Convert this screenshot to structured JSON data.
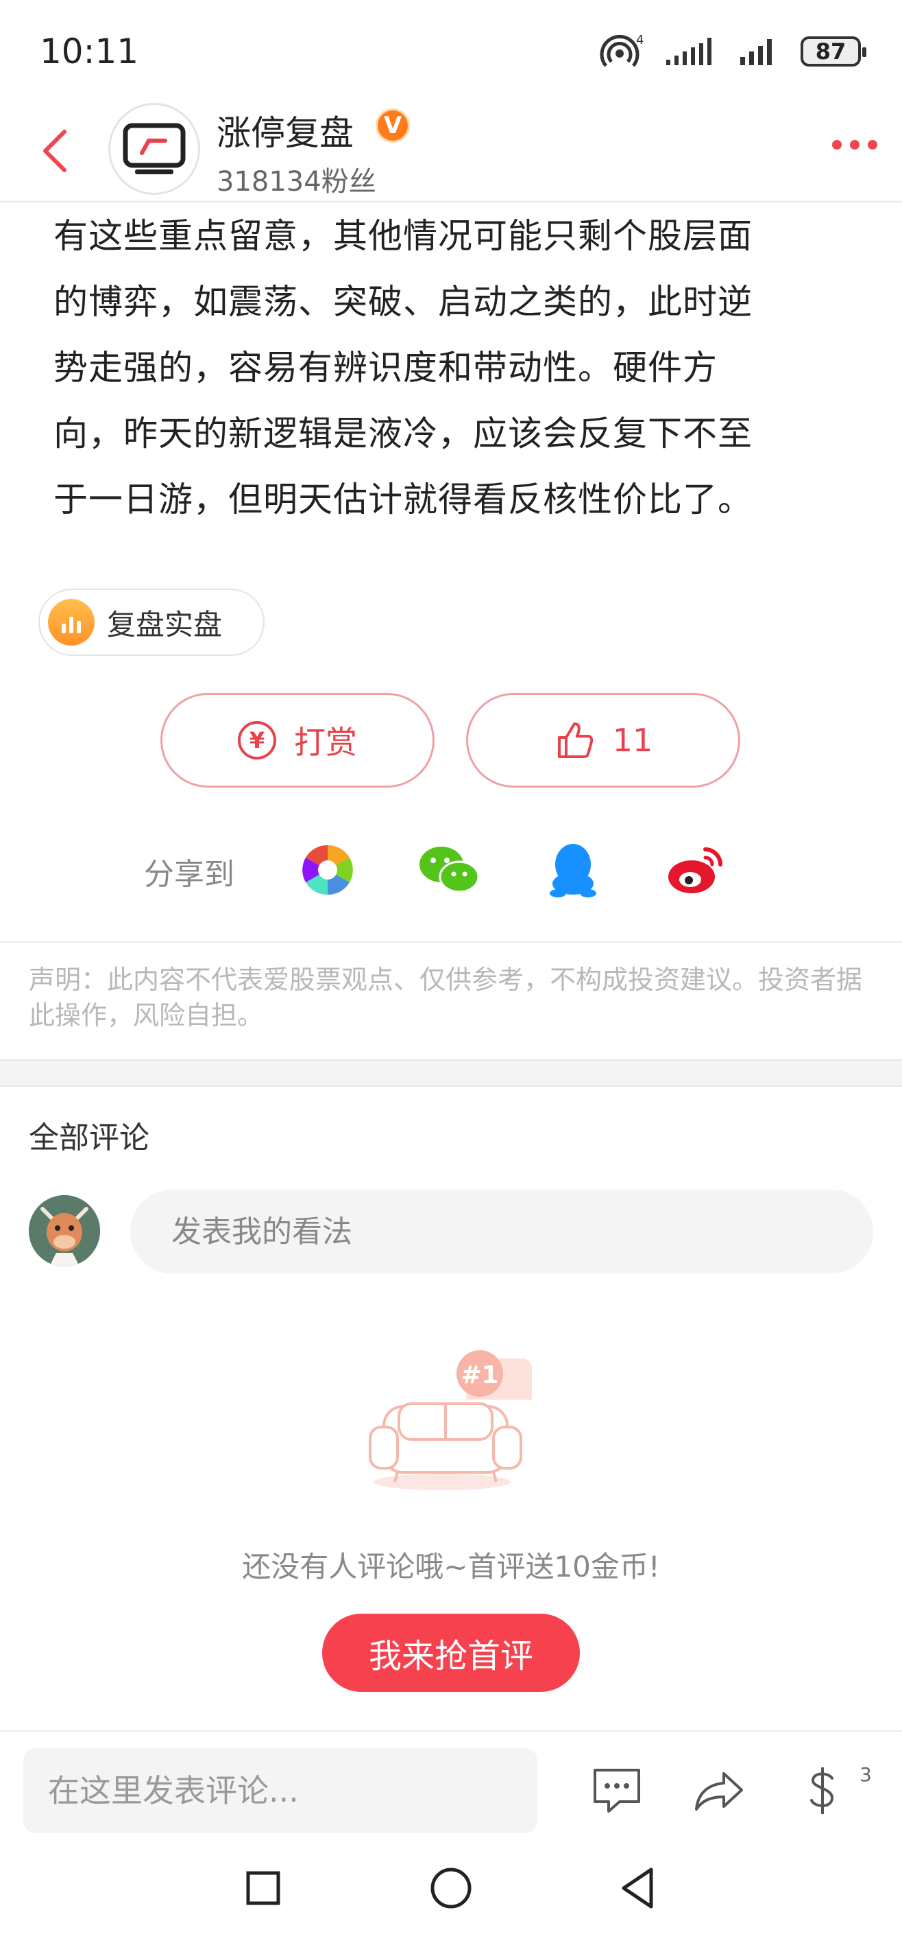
{
  "status_bar": {
    "time": "10:11",
    "battery": "87",
    "hotspot_count": "4"
  },
  "header": {
    "author_name": "涨停复盘",
    "verified_label": "V",
    "fans": "318134粉丝"
  },
  "article": {
    "lines": [
      "有这些重点留意，其他情况可能只剩个股层面",
      "的博弈，如震荡、突破、启动之类的，此时逆",
      "势走强的，容易有辨识度和带动性。硬件方",
      "向，昨天的新逻辑是液冷，应该会反复下不至",
      "于一日游，但明天估计就得看反核性价比了。"
    ]
  },
  "tag": {
    "label": "复盘实盘"
  },
  "actions": {
    "reward_label": "打赏",
    "reward_symbol": "¥",
    "like_count": "11"
  },
  "share": {
    "label": "分享到",
    "targets": [
      "moments-icon",
      "wechat-icon",
      "qq-icon",
      "weibo-icon"
    ]
  },
  "disclaimer": "声明：此内容不代表爱股票观点、仅供参考，不构成投资建议。投资者据此操作，风险自担。",
  "comments": {
    "title": "全部评论",
    "input_placeholder": "发表我的看法",
    "empty_badge": "#1",
    "empty_text": "还没有人评论哦~首评送10金币!",
    "first_comment_button": "我来抢首评"
  },
  "bottom_bar": {
    "input_placeholder": "在这里发表评论...",
    "coin_count": "3"
  },
  "colors": {
    "accent": "#f5424e",
    "verified": "#ff7a1a",
    "tag_icon": "#ffa733"
  }
}
